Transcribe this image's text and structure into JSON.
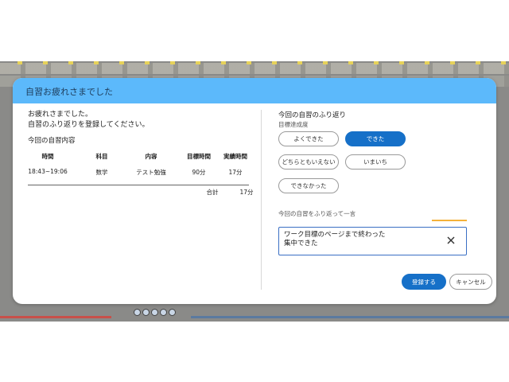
{
  "modal": {
    "title": "自習お疲れさまでした",
    "greeting_line1": "お疲れさまでした。",
    "greeting_line2": "自習のふり返りを登録してください。"
  },
  "session": {
    "title": "今回の自習内容",
    "headers": [
      "時間",
      "科目",
      "内容",
      "目標時間",
      "実績時間"
    ],
    "row": [
      "18:43~19:06",
      "数学",
      "テスト勉強",
      "90分",
      "17分"
    ],
    "total_label": "合計",
    "total_value": "17分"
  },
  "reflection": {
    "title": "今回の自習のふり返り",
    "achievement_label": "目標達成度",
    "options": [
      {
        "label": "よくできた",
        "selected": false
      },
      {
        "label": "できた",
        "selected": true
      },
      {
        "label": "どちらともいえない",
        "selected": false
      },
      {
        "label": "いまいち",
        "selected": false
      },
      {
        "label": "できなかった",
        "selected": false
      }
    ],
    "comment_label": "今回の自習をふり返って一言",
    "comment_value": "ワーク目標のページまで終わった\n集中できた"
  },
  "actions": {
    "register_label": "登録する",
    "cancel_label": "キャンセル"
  },
  "colors": {
    "header": "#5cb9fb",
    "primary": "#1670c8",
    "input_border": "#3a6fc4",
    "accent_line": "#f4b23a"
  }
}
